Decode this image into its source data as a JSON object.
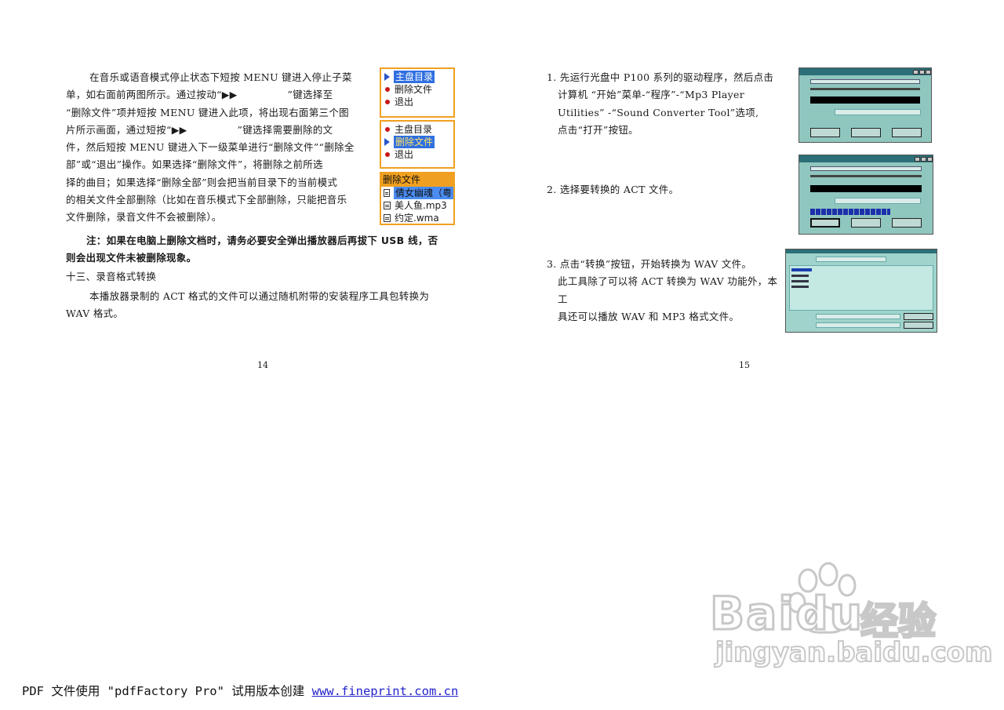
{
  "left_page": {
    "para1_lines": [
      "在音乐或语音模式停止状态下短按 MENU 键进入停止子菜",
      "单，如右面前两图所示。通过按动“▶▶　　　　　”键选择至",
      "“删除文件”项并短按 MENU 键进入此项，将出现右面第三个图",
      "片所示画面，通过短按“▶▶　　　　　”键选择需要删除的文",
      "件，然后短按 MENU 键进入下一级菜单进行“删除文件”“删除全",
      "部”或“退出”操作。如果选择“删除文件”，将删除之前所选",
      "择的曲目；如果选择“删除全部”则会把当前目录下的当前模式",
      "的相关文件全部删除（比如在音乐模式下全部删除，只能把音乐",
      "文件删除，录音文件不会被删除）。"
    ],
    "note_lines": [
      "注：如果在电脑上删除文档时，请务必要安全弹出播放器后再拔下 USB 线，否",
      "则会出现文件未被删除现象。"
    ],
    "section_title": "十三、录音格式转换",
    "para2_lines": [
      "本播放器录制的 ACT 格式的文件可以通过随机附带的安装程序工具包转换为",
      "WAV 格式。"
    ],
    "page_number": "14",
    "menu1": {
      "items": [
        "主盘目录",
        "删除文件",
        "退出"
      ]
    },
    "menu2": {
      "items": [
        "主盘目录",
        "删除文件",
        "退出"
      ]
    },
    "menu3": {
      "header": "删除文件",
      "items": [
        "倩女幽魂（粤",
        "美人鱼.mp3",
        "约定.wma"
      ]
    }
  },
  "right_page": {
    "step1_lines": [
      "1. 先运行光盘中 P100 系列的驱动程序，然后点击",
      "计算机 “开始”菜单-“程序”-“Mp3 Player",
      "Utilities” -“Sound Converter Tool”选项,",
      "点击“打开”按钮。"
    ],
    "step2_lines": [
      "2. 选择要转换的 ACT 文件。"
    ],
    "step3_lines": [
      "3. 点击“转换”按钮，开始转换为 WAV 文件。",
      "此工具除了可以将 ACT 转换为 WAV 功能外，本工",
      "具还可以播放 WAV 和 MP3 格式文件。"
    ],
    "page_number": "15"
  },
  "watermark": {
    "brand": "Baidu",
    "cn": "经验",
    "url": "jingyan.baidu.com"
  },
  "footer": {
    "prefix": "PDF 文件使用 \"pdfFactory Pro\" 试用版本创建 ",
    "link": "www.fineprint.com.cn"
  }
}
